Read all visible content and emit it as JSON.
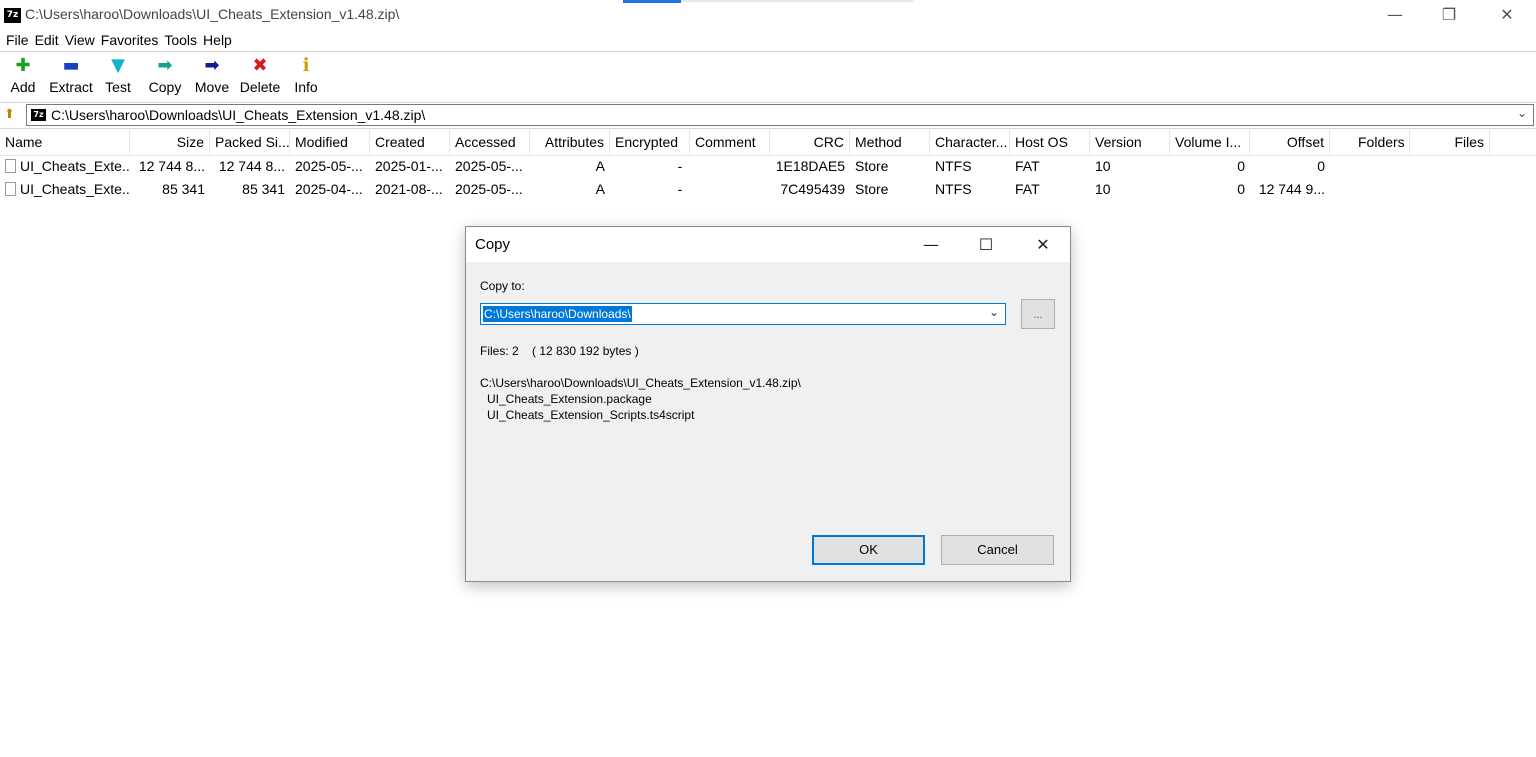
{
  "window": {
    "app_icon_text": "7z",
    "title": "C:\\Users\\haroo\\Downloads\\UI_Cheats_Extension_v1.48.zip\\",
    "minimize_icon": "minimize-icon",
    "restore_icon": "restore-icon",
    "close_icon": "close-icon"
  },
  "menu": [
    "File",
    "Edit",
    "View",
    "Favorites",
    "Tools",
    "Help"
  ],
  "toolbar": [
    {
      "label": "Add",
      "icon": "plus-icon",
      "color": "#1aa01a"
    },
    {
      "label": "Extract",
      "icon": "minus-icon",
      "color": "#1c3fbf"
    },
    {
      "label": "Test",
      "icon": "check-icon",
      "color": "#17b0c8"
    },
    {
      "label": "Copy",
      "icon": "copy-arrow-icon",
      "color": "#1aa090"
    },
    {
      "label": "Move",
      "icon": "move-arrow-icon",
      "color": "#0c1f8f"
    },
    {
      "label": "Delete",
      "icon": "delete-x-icon",
      "color": "#d41a1a"
    },
    {
      "label": "Info",
      "icon": "info-icon",
      "color": "#c8a000"
    }
  ],
  "address": {
    "path": "C:\\Users\\haroo\\Downloads\\UI_Cheats_Extension_v1.48.zip\\"
  },
  "columns": [
    "Name",
    "Size",
    "Packed Si...",
    "Modified",
    "Created",
    "Accessed",
    "Attributes",
    "Encrypted",
    "Comment",
    "CRC",
    "Method",
    "Character...",
    "Host OS",
    "Version",
    "Volume I...",
    "Offset",
    "Folders",
    "Files"
  ],
  "rows": [
    {
      "name": "UI_Cheats_Exte...",
      "size": "12 744 8...",
      "packed": "12 744 8...",
      "modified": "2025-05-...",
      "created": "2025-01-...",
      "accessed": "2025-05-...",
      "attributes": "A",
      "encrypted": "-",
      "comment": "",
      "crc": "1E18DAE5",
      "method": "Store",
      "characteristics": "NTFS",
      "host_os": "FAT",
      "version": "10",
      "volume": "0",
      "offset": "0",
      "folders": "",
      "files": ""
    },
    {
      "name": "UI_Cheats_Exte...",
      "size": "85 341",
      "packed": "85 341",
      "modified": "2025-04-...",
      "created": "2021-08-...",
      "accessed": "2025-05-...",
      "attributes": "A",
      "encrypted": "-",
      "comment": "",
      "crc": "7C495439",
      "method": "Store",
      "characteristics": "NTFS",
      "host_os": "FAT",
      "version": "10",
      "volume": "0",
      "offset": "12 744 9...",
      "folders": "",
      "files": ""
    }
  ],
  "dialog": {
    "title": "Copy",
    "copy_to_label": "Copy to:",
    "copy_to_value": "C:\\Users\\haroo\\Downloads\\",
    "browse_label": "...",
    "files_info": "Files: 2    ( 12 830 192 bytes )",
    "source_path": "C:\\Users\\haroo\\Downloads\\UI_Cheats_Extension_v1.48.zip\\",
    "items": [
      "UI_Cheats_Extension.package",
      "UI_Cheats_Extension_Scripts.ts4script"
    ],
    "ok_label": "OK",
    "cancel_label": "Cancel"
  }
}
